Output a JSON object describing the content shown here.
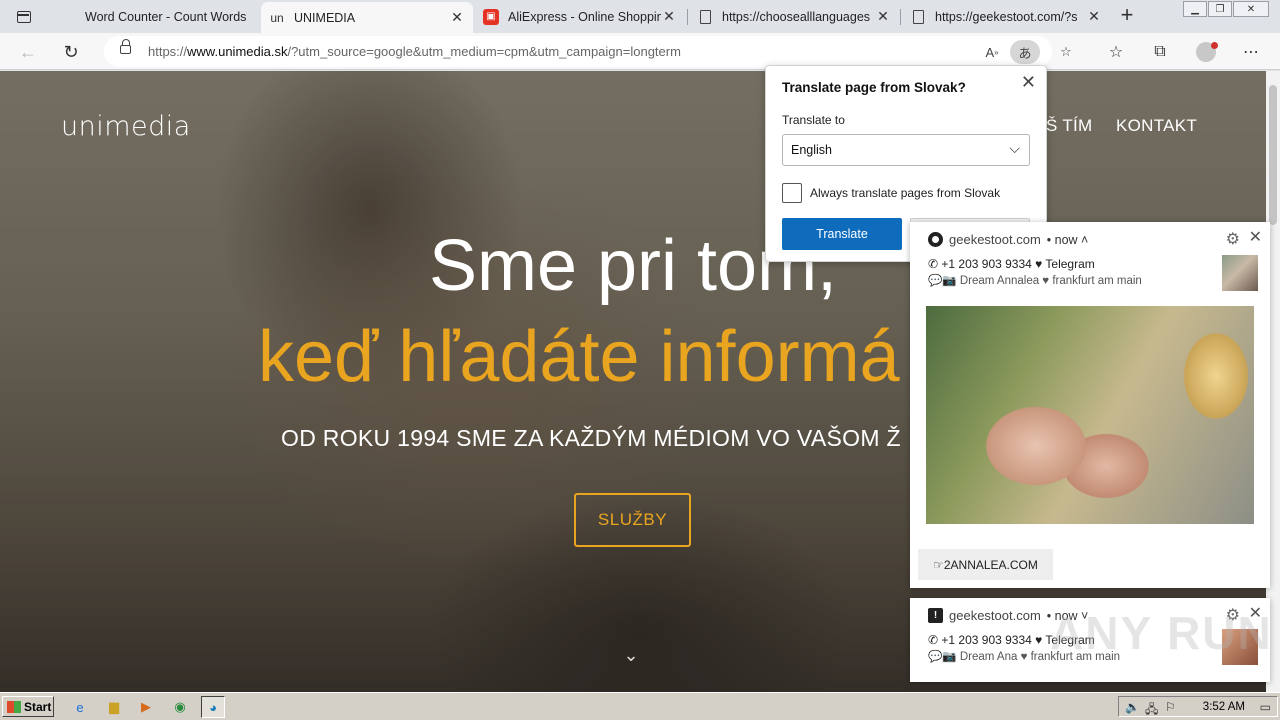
{
  "tabs": [
    {
      "title": "Word Counter - Count Words",
      "icon": "word-counter-icon",
      "active": false
    },
    {
      "title": "UNIMEDIA",
      "icon": "unimedia-icon",
      "fav_text": "un",
      "active": true
    },
    {
      "title": "AliExpress - Online Shopping",
      "icon": "aliexpress-icon",
      "active": false
    },
    {
      "title": "https://choosealllanguages",
      "icon": "document-icon",
      "active": false
    },
    {
      "title": "https://geekestoot.com/?s",
      "icon": "document-icon",
      "active": false
    }
  ],
  "address": {
    "url_prefix": "https://",
    "url_host": "www.unimedia.sk",
    "url_rest": "/?utm_source=google&utm_medium=cpm&utm_campaign=longterm",
    "translate_icon_text": "あ"
  },
  "site": {
    "logo": "unimedia",
    "nav": [
      "Š TÍM",
      "KONTAKT"
    ],
    "hero_line1": "Sme pri tom,",
    "hero_line2": "keď hľadáte informá",
    "hero_line3": "OD ROKU 1994 SME ZA KAŽDÝM MÉDIOM VO VAŠOM Ž",
    "cta": "SLUŽBY",
    "accent_color": "#e9a51f"
  },
  "translate_popup": {
    "title": "Translate page from Slovak?",
    "label": "Translate to",
    "selected_language": "English",
    "checkbox_label": "Always translate pages from Slovak",
    "translate_button": "Translate",
    "button_color": "#0f6cbd"
  },
  "notifications": [
    {
      "site": "geekestoot.com",
      "time": "now",
      "line1": "+1 203 903 9334 ♥ Telegram",
      "line2": "Dream Annalea ♥ frankfurt am main",
      "link_button": "☞2ANNALEA.COM"
    },
    {
      "site": "geekestoot.com",
      "time": "now",
      "line1": "+1 203 903 9334 ♥ Telegram",
      "line2": "Dream Ana ♥ frankfurt am main"
    }
  ],
  "taskbar": {
    "start": "Start",
    "clock": "3:52 AM"
  },
  "watermark": "ANY RUN"
}
